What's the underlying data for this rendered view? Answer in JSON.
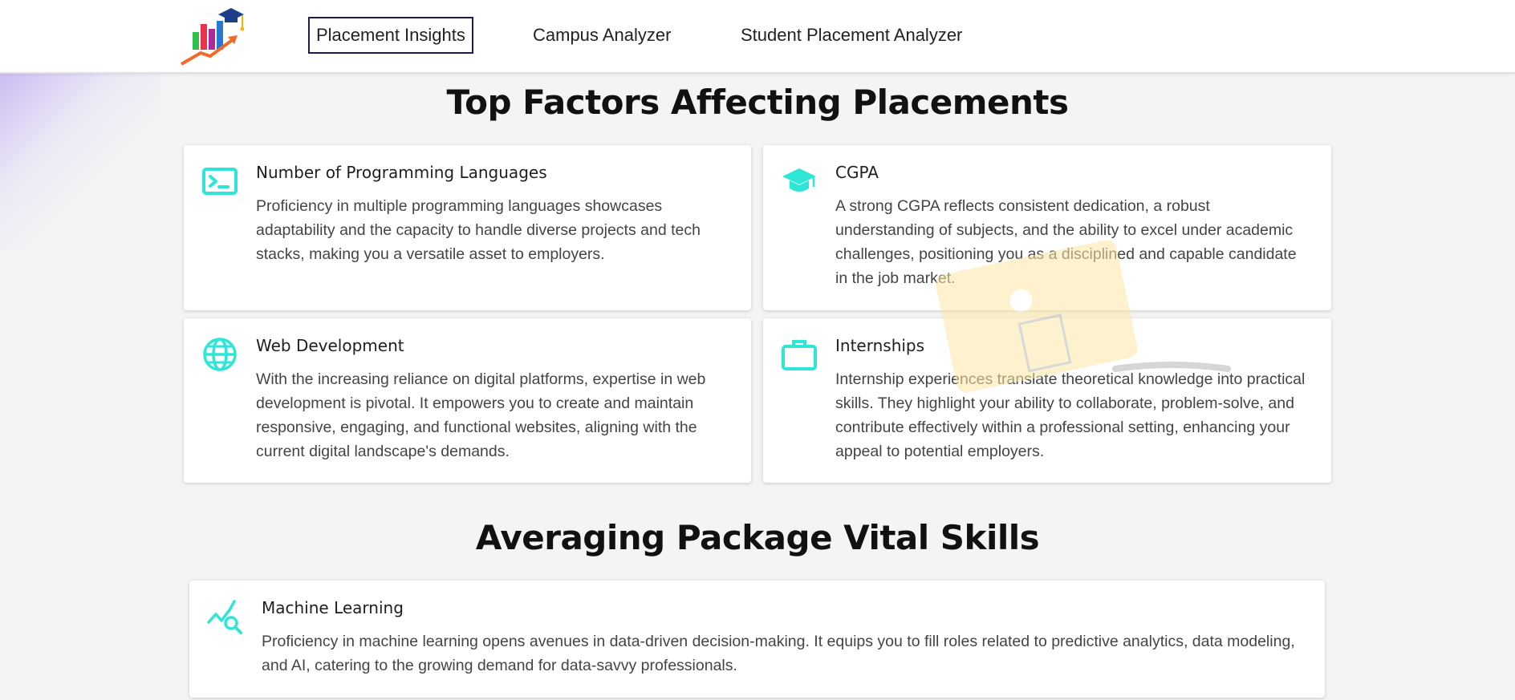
{
  "nav": {
    "logo_icon": "placement-chart-logo",
    "links": [
      {
        "label": "Placement Insights",
        "active": true
      },
      {
        "label": "Campus Analyzer",
        "active": false
      },
      {
        "label": "Student Placement Analyzer",
        "active": false
      }
    ]
  },
  "colors": {
    "accent": "#2ee6d6",
    "nav_active_border": "#1d1b4e",
    "background": "#f4f4f4"
  },
  "factors": {
    "title": "Top Factors Affecting Placements",
    "cards": [
      {
        "icon": "terminal-icon",
        "title": "Number of Programming Languages",
        "description": "Proficiency in multiple programming languages showcases adaptability and the capacity to handle diverse projects and tech stacks, making you a versatile asset to employers."
      },
      {
        "icon": "graduation-cap-icon",
        "title": "CGPA",
        "description": "A strong CGPA reflects consistent dedication, a robust understanding of subjects, and the ability to excel under academic challenges, positioning you as a disciplined and capable candidate in the job market."
      },
      {
        "icon": "globe-icon",
        "title": "Web Development",
        "description": "With the increasing reliance on digital platforms, expertise in web development is pivotal. It empowers you to create and maintain responsive, engaging, and functional websites, aligning with the current digital landscape's demands."
      },
      {
        "icon": "briefcase-icon",
        "title": "Internships",
        "description": "Internship experiences translate theoretical knowledge into practical skills. They highlight your ability to collaborate, problem-solve, and contribute effectively within a professional setting, enhancing your appeal to potential employers."
      }
    ]
  },
  "skills": {
    "title": "Averaging Package Vital Skills",
    "cards": [
      {
        "icon": "chart-search-icon",
        "title": "Machine Learning",
        "description": "Proficiency in machine learning opens avenues in data-driven decision-making. It equips you to fill roles related to predictive analytics, data modeling, and AI, catering to the growing demand for data-savvy professionals."
      }
    ]
  }
}
